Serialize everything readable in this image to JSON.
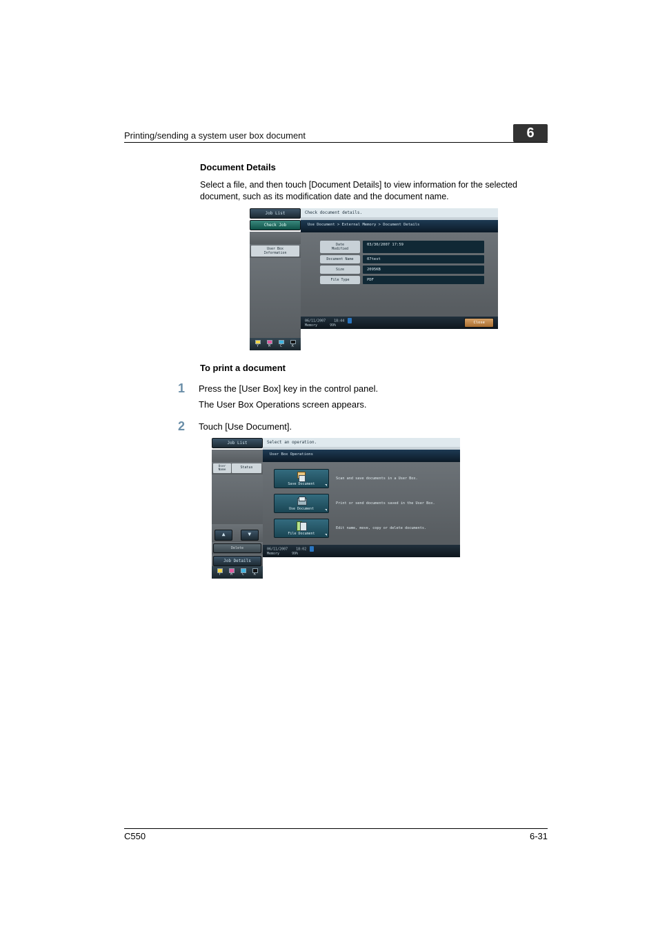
{
  "header": {
    "title": "Printing/sending a system user box document",
    "chapter": "6"
  },
  "section1": {
    "title": "Document Details",
    "para": "Select a file, and then touch [Document Details] to view information for the selected document, such as its modification date and the document name."
  },
  "shot1": {
    "sidebar": {
      "job_list": "Job List",
      "check_job": "Check Job",
      "user_box_info": "User Box\nInformation"
    },
    "msg": "Check document details.",
    "crumbs": "Use Document > External Memory > Document Details",
    "fields": {
      "date_lbl": "Date\nModified",
      "date_val": "03/30/2007 17:59",
      "name_lbl": "Document Name",
      "name_val": "07test",
      "size_lbl": "Size",
      "size_val": "2095KB",
      "type_lbl": "File Type",
      "type_val": "PDF"
    },
    "status": {
      "date": "06/11/2007",
      "time": "18:44",
      "mem_lbl": "Memory",
      "mem_val": "99%",
      "close": "Close"
    },
    "toners": {
      "y": "Y",
      "m": "M",
      "c": "C",
      "k": "K"
    }
  },
  "section2": {
    "title": "To print a document",
    "step1a": "Press the [User Box] key in the control panel.",
    "step1b": "The User Box Operations screen appears.",
    "step2": "Touch [Use Document]."
  },
  "shot2": {
    "sidebar": {
      "job_list": "Job List",
      "user_name": "User\nName",
      "status": "Status",
      "delete": "Delete",
      "job_details": "Job Details"
    },
    "msg": "Select an operation.",
    "crumbs": "User Box Operations",
    "ops": {
      "save_lbl": "Save Document",
      "save_desc": "Scan and save documents in a User Box.",
      "use_lbl": "Use Document",
      "use_desc": "Print or send documents saved in the User Box.",
      "file_lbl": "File Document",
      "file_desc": "Edit name, move, copy or delete documents."
    },
    "status": {
      "date": "06/11/2007",
      "time": "18:02",
      "mem_lbl": "Memory",
      "mem_val": "99%"
    },
    "toners": {
      "y": "Y",
      "m": "M",
      "c": "C",
      "k": "K"
    }
  },
  "footer": {
    "left": "C550",
    "right": "6-31"
  }
}
